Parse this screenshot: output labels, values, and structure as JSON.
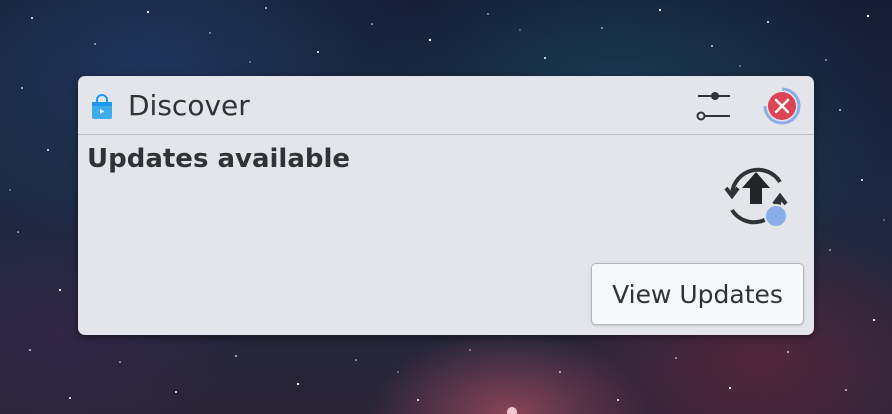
{
  "notification": {
    "app_name": "Discover",
    "title": "Updates available",
    "action_label": "View Updates",
    "config_icon": "settings-sliders-icon",
    "close_icon": "close-icon",
    "app_icon": "discover-bag-icon",
    "update_icon": "system-update-icon"
  },
  "colors": {
    "close_red": "#da4453",
    "badge_blue": "#8aaee8",
    "app_icon_blue": "#3daee9",
    "text": "#2f3338",
    "card_bg": "#e3e5ea"
  }
}
